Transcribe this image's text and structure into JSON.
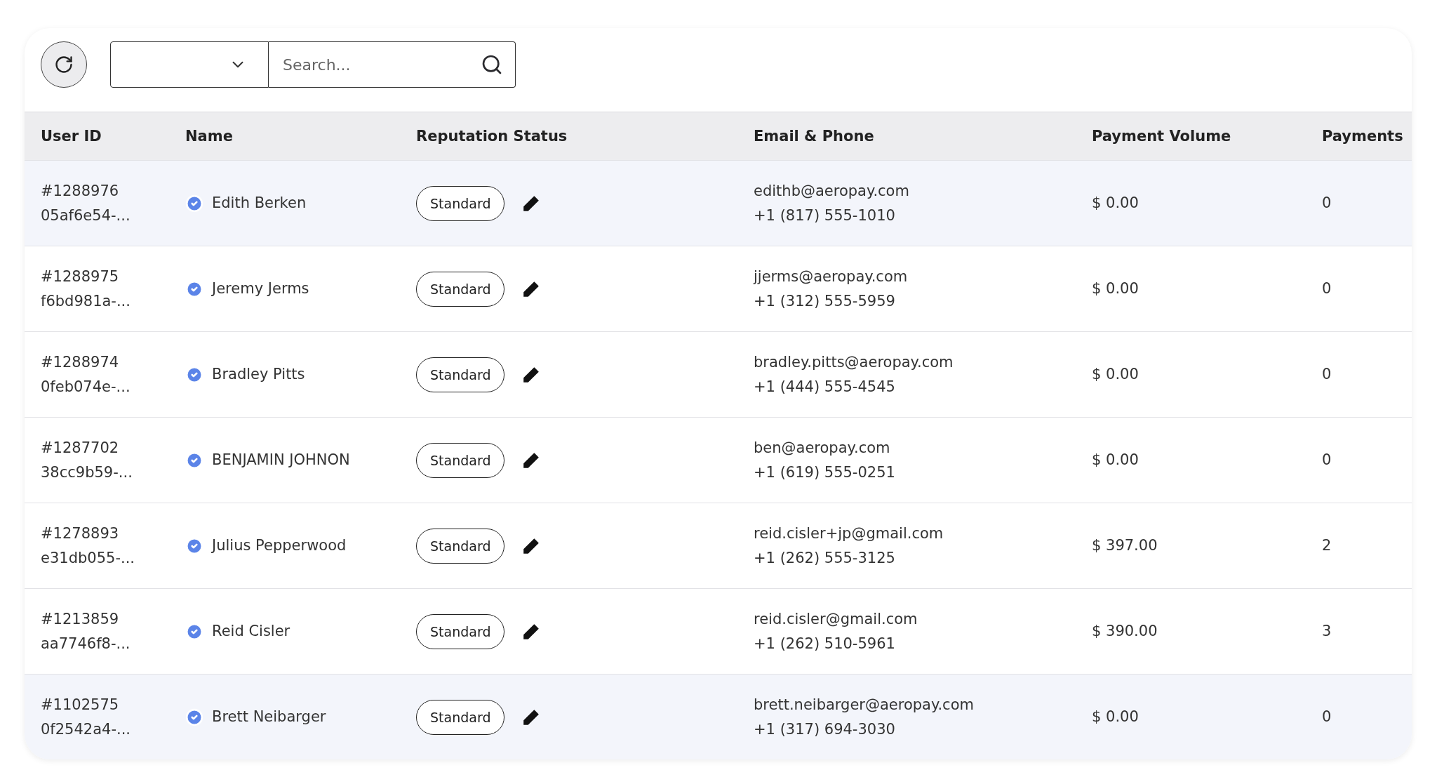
{
  "toolbar": {
    "search": {
      "placeholder": "Search..."
    }
  },
  "table": {
    "columns": [
      "User ID",
      "Name",
      "Reputation Status",
      "Email & Phone",
      "Payment Volume",
      "Payments"
    ],
    "rows": [
      {
        "user_id": "#1288976",
        "uuid": "05af6e54-...",
        "name": "Edith Berken",
        "verified": true,
        "status": "Standard",
        "email": "edithb@aeropay.com",
        "phone": "+1 (817) 555-1010",
        "volume": "$ 0.00",
        "payments": "0",
        "highlighted": true
      },
      {
        "user_id": "#1288975",
        "uuid": "f6bd981a-...",
        "name": "Jeremy Jerms",
        "verified": true,
        "status": "Standard",
        "email": "jjerms@aeropay.com",
        "phone": "+1 (312) 555-5959",
        "volume": "$ 0.00",
        "payments": "0",
        "highlighted": false
      },
      {
        "user_id": "#1288974",
        "uuid": "0feb074e-...",
        "name": "Bradley Pitts",
        "verified": true,
        "status": "Standard",
        "email": "bradley.pitts@aeropay.com",
        "phone": "+1 (444) 555-4545",
        "volume": "$ 0.00",
        "payments": "0",
        "highlighted": false
      },
      {
        "user_id": "#1287702",
        "uuid": "38cc9b59-...",
        "name": "BENJAMIN JOHNON",
        "verified": true,
        "status": "Standard",
        "email": "ben@aeropay.com",
        "phone": "+1 (619) 555-0251",
        "volume": "$ 0.00",
        "payments": "0",
        "highlighted": false
      },
      {
        "user_id": "#1278893",
        "uuid": "e31db055-...",
        "name": "Julius Pepperwood",
        "verified": true,
        "status": "Standard",
        "email": "reid.cisler+jp@gmail.com",
        "phone": "+1 (262) 555-3125",
        "volume": "$ 397.00",
        "payments": "2",
        "highlighted": false
      },
      {
        "user_id": "#1213859",
        "uuid": "aa7746f8-...",
        "name": "Reid Cisler",
        "verified": true,
        "status": "Standard",
        "email": "reid.cisler@gmail.com",
        "phone": "+1 (262) 510-5961",
        "volume": "$ 390.00",
        "payments": "3",
        "highlighted": false
      },
      {
        "user_id": "#1102575",
        "uuid": "0f2542a4-...",
        "name": "Brett Neibarger",
        "verified": true,
        "status": "Standard",
        "email": "brett.neibarger@aeropay.com",
        "phone": "+1 (317) 694-3030",
        "volume": "$ 0.00",
        "payments": "0",
        "highlighted": true
      }
    ]
  }
}
